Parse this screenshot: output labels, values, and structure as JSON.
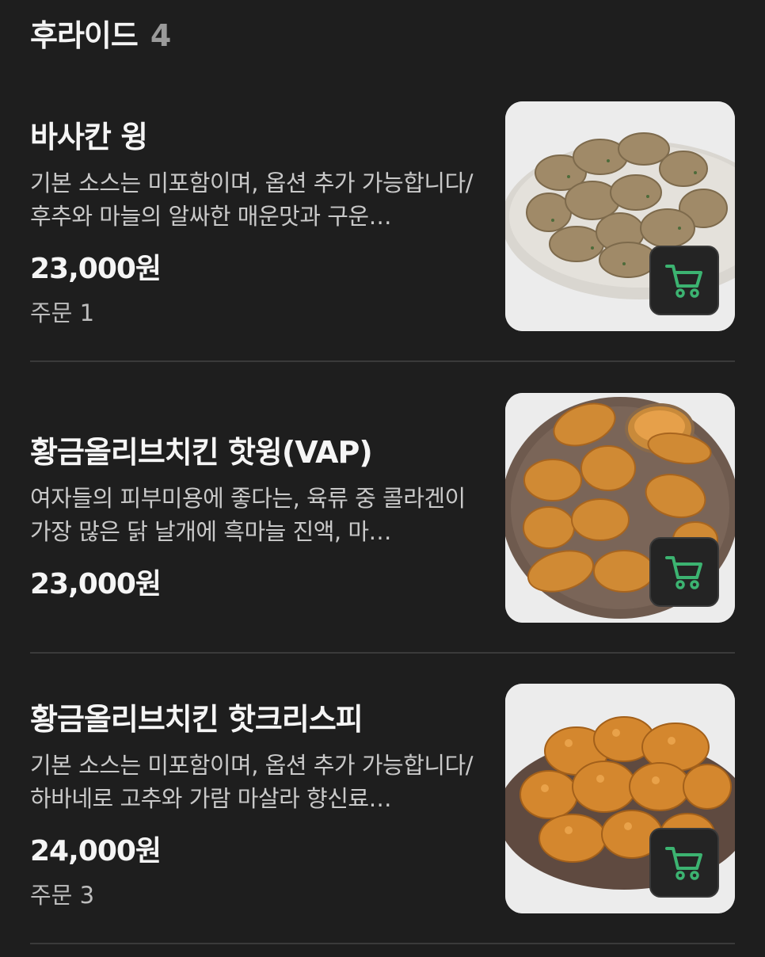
{
  "section": {
    "title": "후라이드",
    "count": "4"
  },
  "items": [
    {
      "name": "바사칸 윙",
      "description": "기본 소스는 미포함이며, 옵션 추가 가능합니다/후추와 마늘의 알싸한 매운맛과 구운…",
      "price": "23,000원",
      "orders": "주문 1",
      "image": "garlic-pepper-wings-plate"
    },
    {
      "name": "황금올리브치킨 핫윙(VAP)",
      "description": "여자들의 피부미용에 좋다는, 육류 중 콜라겐이 가장 많은 닭 날개에 흑마늘 진액, 마…",
      "price": "23,000원",
      "orders": "",
      "image": "fried-wings-with-dip"
    },
    {
      "name": "황금올리브치킨 핫크리스피",
      "description": "기본 소스는 미포함이며, 옵션 추가 가능합니다/하바네로 고추와 가람 마살라 향신료…",
      "price": "24,000원",
      "orders": "주문 3",
      "image": "crispy-fried-chicken"
    }
  ],
  "icons": {
    "cart": "cart-icon"
  },
  "colors": {
    "background": "#1e1e1e",
    "cart_accent": "#3cb371",
    "divider": "#3a3a3a"
  }
}
